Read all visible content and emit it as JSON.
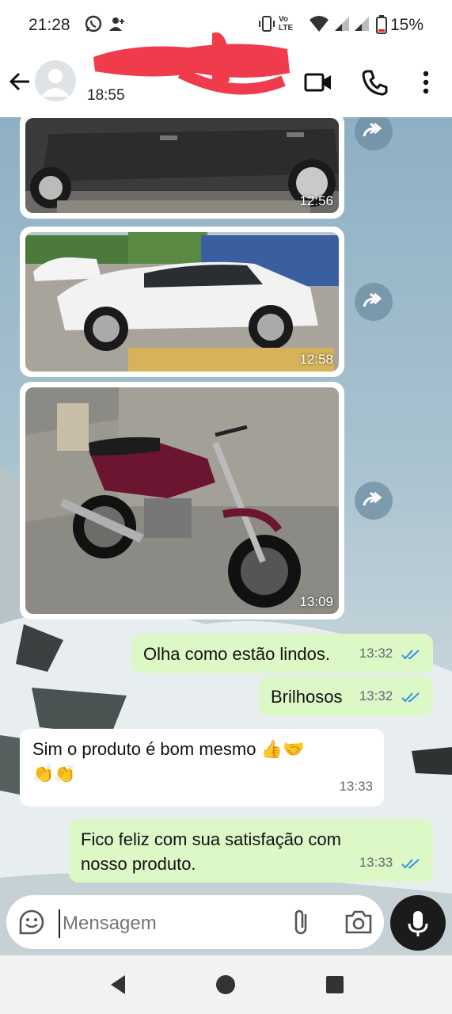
{
  "status_bar": {
    "time": "21:28",
    "battery": "15%",
    "network": "Vo LTE"
  },
  "header": {
    "last_seen": "18:55"
  },
  "images": [
    {
      "time": "12:56",
      "subject": "car-gray"
    },
    {
      "time": "12:58",
      "subject": "car-white"
    },
    {
      "time": "13:09",
      "subject": "motorcycle"
    }
  ],
  "messages": [
    {
      "direction": "out",
      "text": "Olha como estão lindos.",
      "time": "13:32"
    },
    {
      "direction": "out",
      "text": "Brilhosos",
      "time": "13:32"
    },
    {
      "direction": "in",
      "text": "Sim o produto é bom mesmo 👍🤝",
      "text2": "👏👏",
      "time": "13:33"
    },
    {
      "direction": "out",
      "text": "Fico feliz com sua satisfação com",
      "text2": "nosso produto.",
      "time": "13:33"
    }
  ],
  "input": {
    "placeholder": "Mensagem"
  },
  "colors": {
    "outgoing_bubble": "#dcf8c6",
    "incoming_bubble": "#ffffff",
    "read_ticks": "#3a8ee6"
  }
}
